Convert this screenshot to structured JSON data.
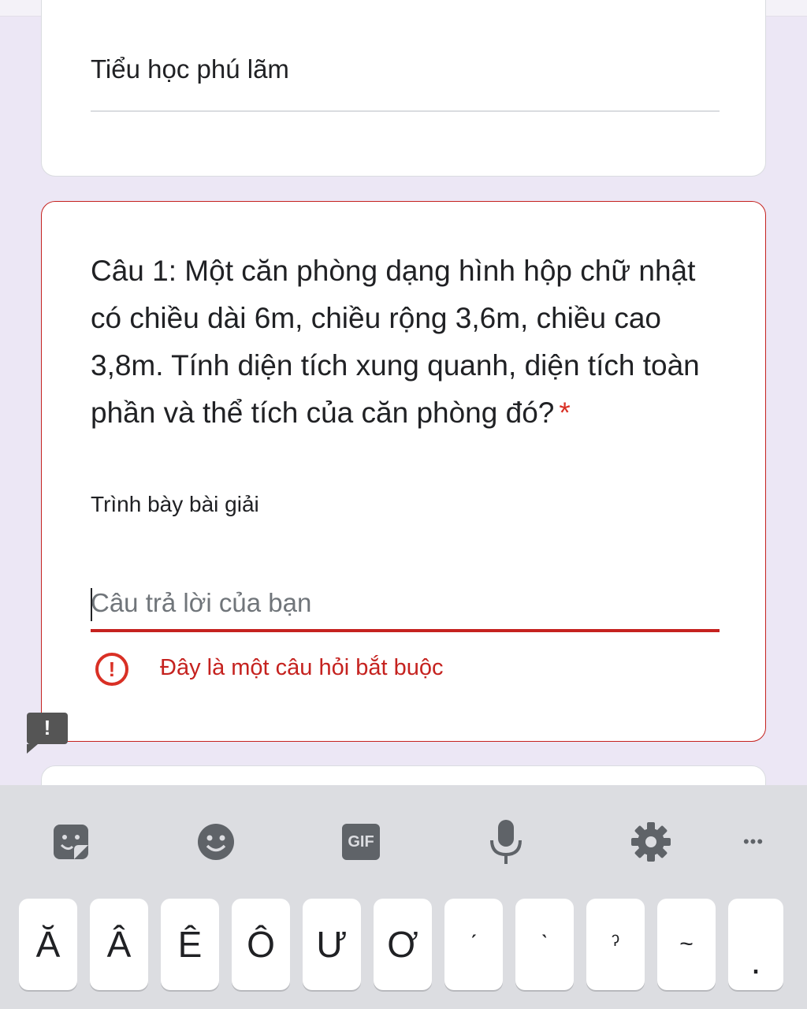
{
  "form": {
    "school_answer": "Tiểu học phú lãm",
    "question": {
      "title": "Câu 1: Một căn phòng dạng hình hộp chữ nhật có chiều dài 6m, chiều rộng 3,6m, chiều cao 3,8m. Tính diện tích xung quanh, diện tích toàn phần và thể tích của căn phòng đó?",
      "required_mark": "*",
      "help_text": "Trình bày bài giải",
      "answer_placeholder": "Câu trả lời của bạn",
      "error_message": "Đây là một câu hỏi bắt buộc"
    }
  },
  "keyboard": {
    "toolbar": [
      {
        "name": "sticker-icon"
      },
      {
        "name": "emoji-icon"
      },
      {
        "name": "gif-icon",
        "label": "GIF"
      },
      {
        "name": "microphone-icon"
      },
      {
        "name": "settings-icon"
      },
      {
        "name": "more-icon",
        "label": "•••"
      }
    ],
    "keys": [
      "Ă",
      "Â",
      "Ê",
      "Ô",
      "Ư",
      "Ơ",
      "ˊ",
      "ˋ",
      "ˀ",
      "~",
      "."
    ]
  },
  "colors": {
    "error": "#c5221f",
    "background": "#ece7f5",
    "keyboard": "#dcdde1"
  }
}
